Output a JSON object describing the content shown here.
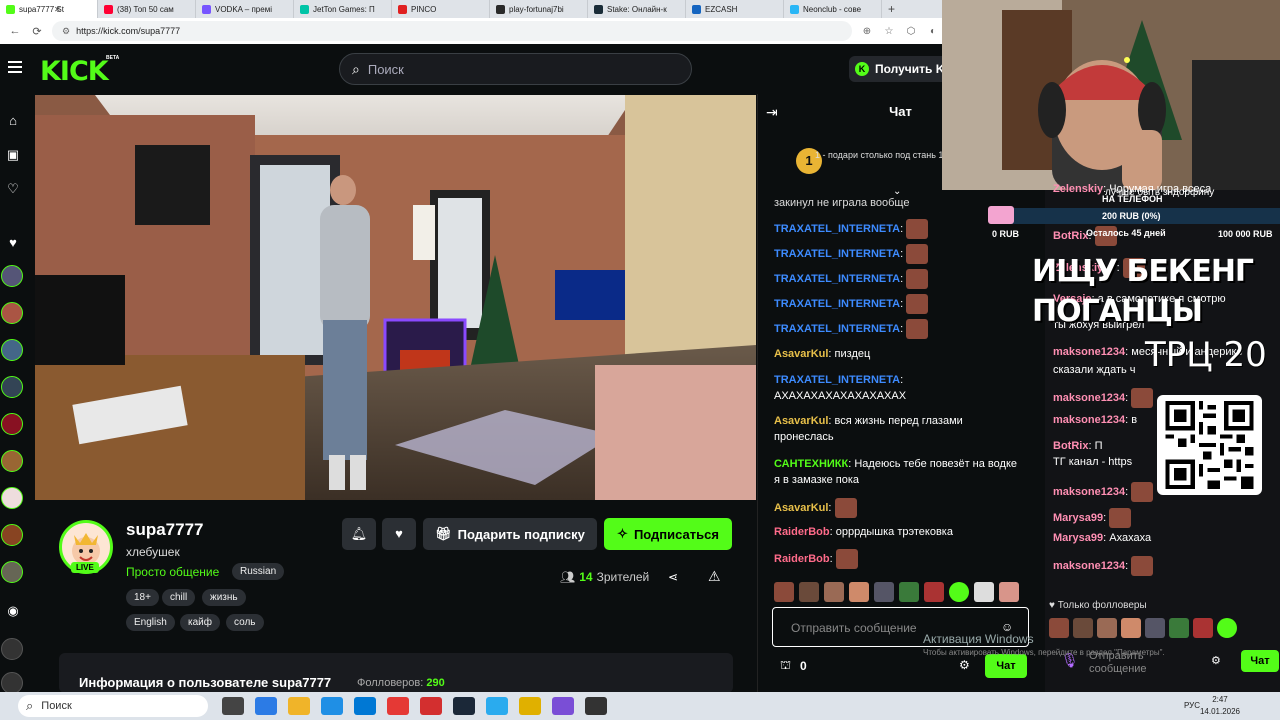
{
  "browser": {
    "tabs": [
      {
        "label": "supa7777 St",
        "color": "#53fc18",
        "active": true
      },
      {
        "label": "(38) Топ 50 сам",
        "color": "#ff0033"
      },
      {
        "label": "VODKA – премі",
        "color": "#7755ff"
      },
      {
        "label": "JetTon Games: П",
        "color": "#00c4a7"
      },
      {
        "label": "PINCO",
        "color": "#e02020"
      },
      {
        "label": "play-fortunaj7bi",
        "color": "#2a2a2a"
      },
      {
        "label": "Stake: Онлайн-к",
        "color": "#1a2c38"
      },
      {
        "label": "EZCASH",
        "color": "#1565c0"
      },
      {
        "label": "Neonclub - сове",
        "color": "#29b6f6"
      }
    ],
    "url": "https://kick.com/supa7777",
    "close_x": "✕",
    "new_tab": "+"
  },
  "header": {
    "logo": "KICK",
    "beta": "BETA",
    "search_placeholder": "Поиск",
    "get_kick": "Получить K"
  },
  "channel": {
    "name": "supa7777",
    "title": "хлебушек",
    "category": "Просто общение",
    "language": "Russian",
    "live": "LIVE",
    "tags": [
      "18+",
      "chill",
      "жизнь",
      "English",
      "кайф",
      "соль"
    ],
    "gift_sub": "Подарить подписку",
    "subscribe": "Подписаться",
    "viewers_count": "14",
    "viewers_label": "Зрителей",
    "about_title": "Информация о пользователе supa7777",
    "followers_label": "Фолловеров:",
    "followers_count": "290"
  },
  "chat": {
    "title": "Чат",
    "pinned_rank": "1",
    "pinned_text": "1 - подари столько под стань 1-м",
    "partial_top": "закинул не играла вообще",
    "messages": [
      {
        "user": "TRAXATEL_INTERNETA",
        "color": "#3d8bff",
        "text": ""
      },
      {
        "user": "TRAXATEL_INTERNETA",
        "color": "#3d8bff",
        "text": ""
      },
      {
        "user": "TRAXATEL_INTERNETA",
        "color": "#3d8bff",
        "text": ""
      },
      {
        "user": "TRAXATEL_INTERNETA",
        "color": "#3d8bff",
        "text": ""
      },
      {
        "user": "TRAXATEL_INTERNETA",
        "color": "#3d8bff",
        "text": ""
      },
      {
        "user": "AsavarKul",
        "color": "#e8c04a",
        "text": "пиздец"
      },
      {
        "user": "TRAXATEL_INTERNETA",
        "color": "#3d8bff",
        "text": "АХАХАХАХАХАХАХАХАХ"
      },
      {
        "user": "AsavarKul",
        "color": "#e8c04a",
        "text": "вся жизнь перед глазами пронеслась"
      },
      {
        "user": "САНТЕХНИКК",
        "color": "#53fc18",
        "text": "Надеюсь тебе повезёт на водке я в замазке пока"
      },
      {
        "user": "AsavarKul",
        "color": "#e8c04a",
        "text": ""
      },
      {
        "user": "RaiderBob",
        "color": "#ff6b8a",
        "text": "орррдышка трэтековка"
      },
      {
        "user": "RaiderBob",
        "color": "#ff6b8a",
        "text": ""
      }
    ],
    "input_placeholder": "Отправить сообщение",
    "send": "Чат",
    "count": "0"
  },
  "overlay": {
    "donate_phone": "НА ТЕЛЕФОН",
    "donate_progress": "200 RUB (0%)",
    "donate_days": "Осталось 45 дней",
    "donate_left": "0 RUB",
    "donate_right": "100 000 RUB",
    "partial1": "лучше быть зндорфину",
    "big_text_1": "ИЩУ БЕКЕНГ",
    "big_text_2": "ПОГАНЦЫ",
    "trc": "ТРЦ 20",
    "messages": [
      {
        "user": "Zelenskiy",
        "text": "Чорумая игра всеса"
      },
      {
        "user": "BotRix",
        "text": ""
      },
      {
        "user": "Zelenskiy_V",
        "text": ""
      },
      {
        "user": "Versaje",
        "text": "а в самолетике я смотрю"
      },
      {
        "user": "",
        "text": "ты жохуя выигрел"
      },
      {
        "user": "maksone1234",
        "text": "месячный и андерике"
      },
      {
        "user": "",
        "text": "сказали ждать ч"
      },
      {
        "user": "maksone1234",
        "text": ""
      },
      {
        "user": "maksone1234",
        "text": "в"
      },
      {
        "user": "BotRix",
        "text": "П"
      },
      {
        "user": "",
        "text": "ТГ канал - https"
      },
      {
        "user": "maksone1234",
        "text": ""
      },
      {
        "user": "Marysa99",
        "text": ""
      },
      {
        "user": "Marysa99",
        "text": "Ахахаха"
      },
      {
        "user": "maksone1234",
        "text": ""
      }
    ],
    "followers_only": "Только фолловеры",
    "send": "Чат",
    "input_placeholder": "Отправить сообщение",
    "activation_title": "Активация Windows",
    "activation_sub": "Чтобы активировать Windows, перейдите в раздел \"Параметры\"."
  },
  "taskbar": {
    "search": "Поиск",
    "lang": "РУС",
    "time": "2:47",
    "date": "14.01.2026"
  }
}
